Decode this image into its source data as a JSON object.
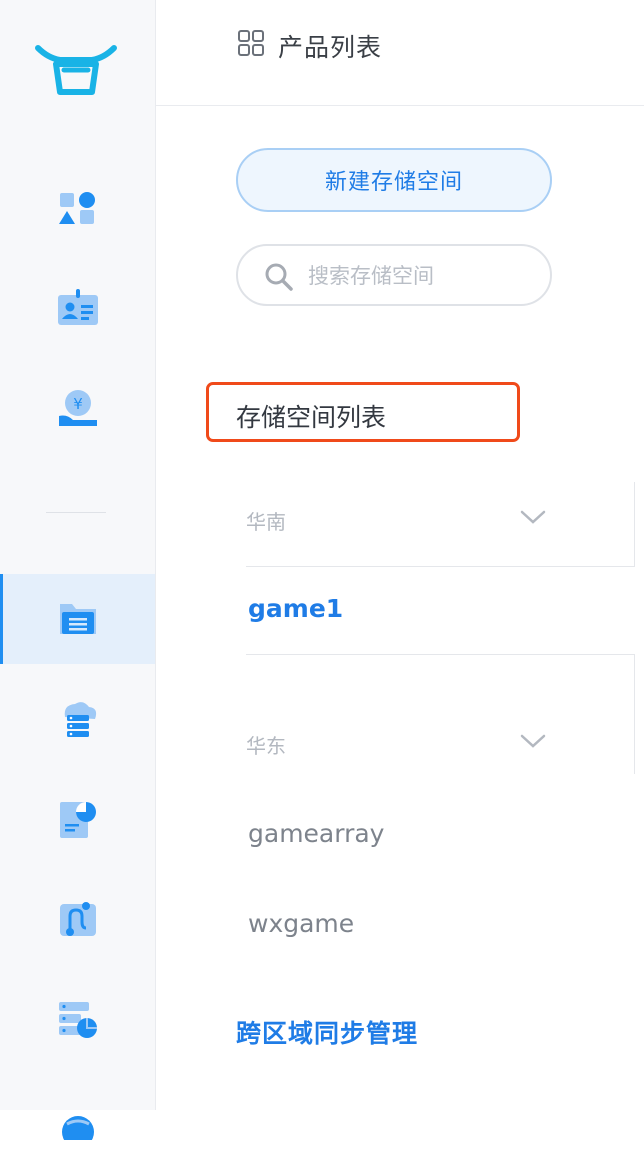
{
  "header": {
    "title": "产品列表"
  },
  "actions": {
    "new_bucket": "新建存储空间"
  },
  "search": {
    "placeholder": "搜索存储空间",
    "value": ""
  },
  "bucket_list": {
    "title": "存储空间列表",
    "regions": [
      {
        "name": "华南",
        "buckets": [
          "game1"
        ]
      },
      {
        "name": "华东",
        "buckets": [
          "gamearray",
          "wxgame"
        ]
      }
    ],
    "active_bucket": "game1"
  },
  "links": {
    "cross_region_sync": "跨区域同步管理"
  },
  "colors": {
    "accent": "#1f7ce6",
    "highlight": "#f04a1a",
    "rail_bg": "#f7f8fa",
    "logo": "#19b3e6"
  }
}
